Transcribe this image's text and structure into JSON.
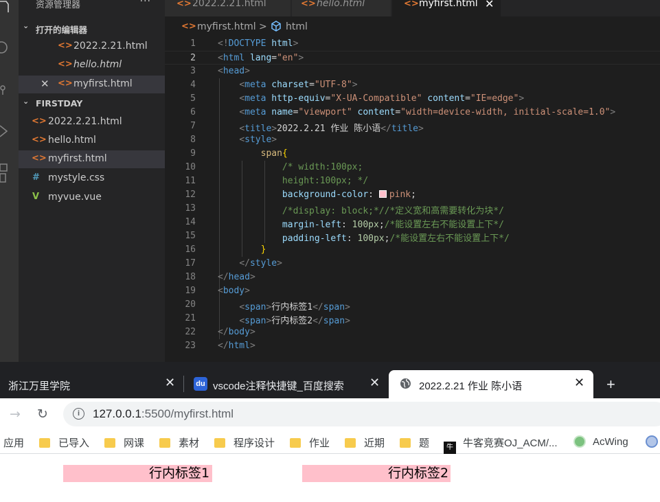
{
  "sidebar": {
    "title": "资源管理器",
    "more": "···",
    "open_editors": {
      "label": "打开的编辑器",
      "items": [
        {
          "name": "2022.2.21.html",
          "italic": false,
          "close": false
        },
        {
          "name": "hello.html",
          "italic": true,
          "close": false
        },
        {
          "name": "myfirst.html",
          "italic": false,
          "close": true
        }
      ]
    },
    "workspace": {
      "label": "FIRSTDAY",
      "items": [
        {
          "name": "2022.2.21.html",
          "icon": "<>"
        },
        {
          "name": "hello.html",
          "icon": "<>"
        },
        {
          "name": "myfirst.html",
          "icon": "<>"
        },
        {
          "name": "mystyle.css",
          "icon": "#"
        },
        {
          "name": "myvue.vue",
          "icon": "V"
        }
      ]
    }
  },
  "editor": {
    "tabs": [
      {
        "label": "2022.2.21.html",
        "icon": "<>"
      },
      {
        "label": "hello.html",
        "icon": "<>"
      },
      {
        "label": "myfirst.html",
        "icon": "<>",
        "close": "✕"
      }
    ],
    "breadcrumb": {
      "file": "myfirst.html",
      "separator": ">",
      "symbol": "html"
    },
    "current_line": 2,
    "lines": [
      {
        "n": "1"
      },
      {
        "n": "2"
      },
      {
        "n": "3"
      },
      {
        "n": "4"
      },
      {
        "n": "5"
      },
      {
        "n": "6"
      },
      {
        "n": "7"
      },
      {
        "n": "8"
      },
      {
        "n": "9"
      },
      {
        "n": "10"
      },
      {
        "n": "11"
      },
      {
        "n": "12"
      },
      {
        "n": "13"
      },
      {
        "n": "14"
      },
      {
        "n": "15"
      },
      {
        "n": "16"
      },
      {
        "n": "17"
      },
      {
        "n": "18"
      },
      {
        "n": "19"
      },
      {
        "n": "20"
      },
      {
        "n": "21"
      },
      {
        "n": "22"
      },
      {
        "n": "23"
      }
    ],
    "code": {
      "l1": [
        "<!",
        "DOCTYPE",
        " html",
        ">"
      ],
      "l2": [
        "<",
        "html",
        " lang",
        "=",
        "\"en\"",
        ">"
      ],
      "l3": [
        "<",
        "head",
        ">"
      ],
      "l4": [
        "<",
        "meta",
        " charset",
        "=",
        "\"UTF-8\"",
        ">"
      ],
      "l5": [
        "<",
        "meta",
        " http-equiv",
        "=",
        "\"X-UA-Compatible\"",
        " content",
        "=",
        "\"IE=edge\"",
        ">"
      ],
      "l6": [
        "<",
        "meta",
        " name",
        "=",
        "\"viewport\"",
        " content",
        "=",
        "\"width=device-width, initial-scale=1.0\"",
        ">"
      ],
      "l7": [
        "<",
        "title",
        ">",
        "2022.2.21 作业 陈小语",
        "</",
        "title",
        ">"
      ],
      "l8": [
        "<",
        "style",
        ">"
      ],
      "l9": [
        "span",
        "{"
      ],
      "l10": [
        "/* width:100px;"
      ],
      "l11": [
        "height:100px; */"
      ],
      "l12": [
        "background-color",
        ": ",
        "pink",
        ";"
      ],
      "l13": [
        "/*display: block;*//*定义宽和高需要转化为块*/"
      ],
      "l14": [
        "margin-left",
        ": ",
        "100px",
        ";",
        "/*能设置左右不能设置上下*/"
      ],
      "l15": [
        "padding-left",
        ": ",
        "100px",
        ";",
        "/*能设置左右不能设置上下*/"
      ],
      "l16": [
        "}"
      ],
      "l17": [
        "</",
        "style",
        ">"
      ],
      "l18": [
        "</",
        "head",
        ">"
      ],
      "l19": [
        "<",
        "body",
        ">"
      ],
      "l20": [
        "<",
        "span",
        ">",
        "行内标签1",
        "</",
        "span",
        ">"
      ],
      "l21": [
        "<",
        "span",
        ">",
        "行内标签2",
        "</",
        "span",
        ">"
      ],
      "l22": [
        "</",
        "body",
        ">"
      ],
      "l23": [
        "</",
        "html",
        ">"
      ]
    }
  },
  "colors": {
    "pink": "#ffc0cb",
    "vscode_bg": "#1e1e1e",
    "chrome_tabstrip": "#202124"
  },
  "browser": {
    "tabs": [
      {
        "title": "浙江万里学院",
        "close": "✕"
      },
      {
        "title": "vscode注释快捷键_百度搜索",
        "close": "✕",
        "icon": "baidu-icon"
      },
      {
        "title": "2022.2.21 作业 陈小语",
        "close": "✕",
        "icon": "globe-icon",
        "active": true
      }
    ],
    "new_tab": "+",
    "nav": {
      "forward": "→",
      "reload": "↻"
    },
    "url": {
      "host": "127.0.0.1",
      "path": ":5500/myfirst.html",
      "info": "i"
    },
    "bookmarks": [
      {
        "label": "应用",
        "type": "apps"
      },
      {
        "label": "已导入",
        "type": "folder"
      },
      {
        "label": "网课",
        "type": "folder"
      },
      {
        "label": "素材",
        "type": "folder"
      },
      {
        "label": "程序设计",
        "type": "folder"
      },
      {
        "label": "作业",
        "type": "folder"
      },
      {
        "label": "近期",
        "type": "folder"
      },
      {
        "label": "题",
        "type": "folder"
      },
      {
        "label": "牛客竞赛OJ_ACM/...",
        "type": "site"
      },
      {
        "label": "AcWing",
        "type": "site"
      }
    ],
    "page": {
      "spans": [
        "行内标签1",
        "行内标签2"
      ]
    }
  }
}
